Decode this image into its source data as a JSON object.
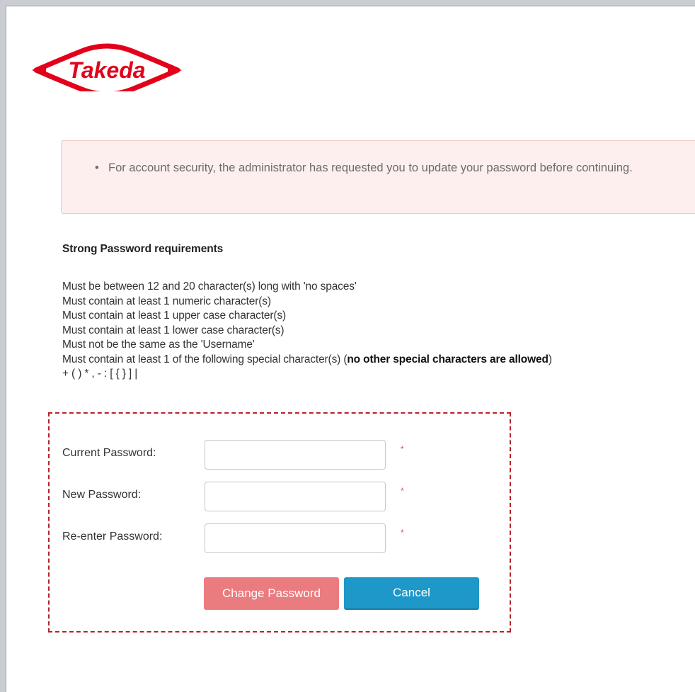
{
  "brand": {
    "logo_text": "Takeda",
    "logo_color": "#e3001b"
  },
  "alert": {
    "message": "For account security, the administrator has requested you to update your password before continuing.",
    "background": "#fcefee"
  },
  "requirements": {
    "title": "Strong Password requirements",
    "lines": [
      "Must be between 12 and 20 character(s) long with 'no spaces'",
      "Must contain at least 1 numeric character(s)",
      "Must contain at least 1 upper case character(s)",
      "Must contain at least 1 lower case character(s)",
      "Must not be the same as the 'Username'"
    ],
    "special_prefix": "Must contain at least 1 of the following special character(s) (",
    "special_bold": "no other special characters are allowed",
    "special_suffix": ")",
    "special_chars": "+ ( ) * , - : [ { } ] |"
  },
  "form": {
    "current_password": {
      "label": "Current Password:",
      "value": "",
      "required_mark": "*"
    },
    "new_password": {
      "label": "New Password:",
      "value": "",
      "required_mark": "*"
    },
    "reenter_password": {
      "label": "Re-enter Password:",
      "value": "",
      "required_mark": "*"
    },
    "change_button": "Change Password",
    "cancel_button": "Cancel",
    "highlight_color": "#b3242c"
  },
  "colors": {
    "change_button": "#ea7b7e",
    "cancel_button": "#1e97c9",
    "required": "#d9534f"
  }
}
